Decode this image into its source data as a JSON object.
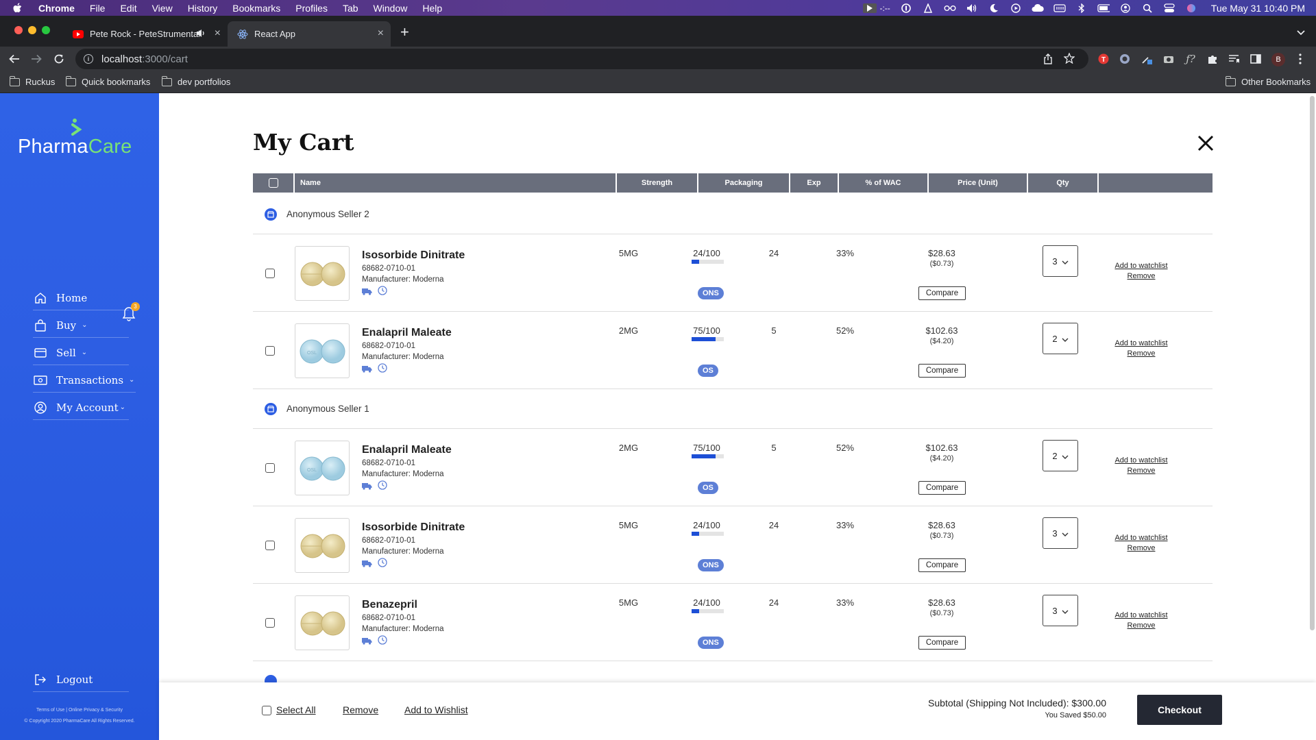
{
  "menubar": {
    "app": "Chrome",
    "items": [
      "File",
      "Edit",
      "View",
      "History",
      "Bookmarks",
      "Profiles",
      "Tab",
      "Window",
      "Help"
    ],
    "media_time": "-:--",
    "clock": "Tue May 31  10:40 PM"
  },
  "tabs": [
    {
      "title": "Pete Rock - PeteStrumentals",
      "favicon": "youtube-icon"
    },
    {
      "title": "React App",
      "favicon": "react-icon"
    }
  ],
  "toolbar": {
    "url_host": "localhost",
    "url_rest": ":3000/cart",
    "profile_initial": "B"
  },
  "bookmarks": {
    "items": [
      "Ruckus",
      "Quick bookmarks",
      "dev portfolios"
    ],
    "other": "Other Bookmarks"
  },
  "sidebar": {
    "logo_a": "Pharma",
    "logo_b": "Care",
    "nav": [
      {
        "label": "Home",
        "icon": "home-icon"
      },
      {
        "label": "Buy",
        "icon": "shopping-bag-icon"
      },
      {
        "label": "Sell",
        "icon": "sell-card-icon"
      },
      {
        "label": "Transactions",
        "icon": "transactions-icon"
      },
      {
        "label": "My Account",
        "icon": "user-icon"
      }
    ],
    "notifications": "3",
    "logout": "Logout",
    "legal_1": "Terms of Use | Online Privacy & Security",
    "legal_2": "© Copyright 2020 PharmaCare All Rights Reserved."
  },
  "cart": {
    "title": "My Cart",
    "columns": {
      "name": "Name",
      "strength": "Strength",
      "packaging": "Packaging",
      "exp": "Exp",
      "wac": "% of WAC",
      "price": "Price (Unit)",
      "qty": "Qty"
    },
    "sellers": [
      {
        "name": "Anonymous Seller 2",
        "items": [
          {
            "name": "Isosorbide Dinitrate",
            "code": "68682-0710-01",
            "mfr": "Manufacturer: Moderna",
            "strength": "5MG",
            "packaging": "24/100",
            "pack_fraction": 0.24,
            "tag": "ONS",
            "exp": "24",
            "wac": "33%",
            "price": "$28.63",
            "unit": "($0.73)",
            "qty": "3",
            "pill": "tan"
          },
          {
            "name": "Enalapril Maleate",
            "code": "68682-0710-01",
            "mfr": "Manufacturer: Moderna",
            "strength": "2MG",
            "packaging": "75/100",
            "pack_fraction": 0.75,
            "tag": "OS",
            "exp": "5",
            "wac": "52%",
            "price": "$102.63",
            "unit": "($4.20)",
            "qty": "2",
            "pill": "blue"
          }
        ]
      },
      {
        "name": "Anonymous Seller 1",
        "items": [
          {
            "name": "Enalapril Maleate",
            "code": "68682-0710-01",
            "mfr": "Manufacturer: Moderna",
            "strength": "2MG",
            "packaging": "75/100",
            "pack_fraction": 0.75,
            "tag": "OS",
            "exp": "5",
            "wac": "52%",
            "price": "$102.63",
            "unit": "($4.20)",
            "qty": "2",
            "pill": "blue"
          },
          {
            "name": "Isosorbide Dinitrate",
            "code": "68682-0710-01",
            "mfr": "Manufacturer: Moderna",
            "strength": "5MG",
            "packaging": "24/100",
            "pack_fraction": 0.24,
            "tag": "ONS",
            "exp": "24",
            "wac": "33%",
            "price": "$28.63",
            "unit": "($0.73)",
            "qty": "3",
            "pill": "tan"
          },
          {
            "name": "Benazepril",
            "code": "68682-0710-01",
            "mfr": "Manufacturer: Moderna",
            "strength": "5MG",
            "packaging": "24/100",
            "pack_fraction": 0.24,
            "tag": "ONS",
            "exp": "24",
            "wac": "33%",
            "price": "$28.63",
            "unit": "($0.73)",
            "qty": "3",
            "pill": "tan"
          }
        ]
      }
    ],
    "compare_label": "Compare",
    "watchlist_label": "Add to watchlist",
    "remove_label": "Remove"
  },
  "footer": {
    "select_all": "Select All",
    "remove": "Remove",
    "wishlist": "Add to Wishlist",
    "subtotal": "Subtotal (Shipping Not Included): $300.00",
    "saved": "You Saved $50.00",
    "checkout": "Checkout"
  },
  "colors": {
    "sidebar": "#2d5ee3",
    "logo_accent": "#79e276",
    "header_bg": "#696e7c",
    "checkout_bg": "#242833"
  }
}
